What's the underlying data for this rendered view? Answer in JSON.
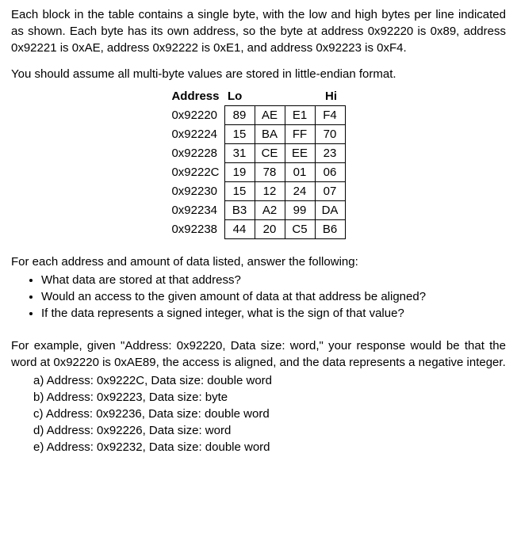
{
  "intro_para": "Each block in the table contains a single byte, with the low and high bytes per line indicated as shown. Each byte has its own address, so the byte at address 0x92220 is 0x89, address 0x92221 is 0xAE, address 0x92222 is 0xE1, and address 0x92223 is 0xF4.",
  "assume_para": "You should assume all multi-byte values are stored in little-endian format.",
  "table": {
    "header_addr": "Address",
    "header_lo": "Lo",
    "header_hi": "Hi",
    "rows": [
      {
        "addr": "0x92220",
        "b0": "89",
        "b1": "AE",
        "b2": "E1",
        "b3": "F4"
      },
      {
        "addr": "0x92224",
        "b0": "15",
        "b1": "BA",
        "b2": "FF",
        "b3": "70"
      },
      {
        "addr": "0x92228",
        "b0": "31",
        "b1": "CE",
        "b2": "EE",
        "b3": "23"
      },
      {
        "addr": "0x9222C",
        "b0": "19",
        "b1": "78",
        "b2": "01",
        "b3": "06"
      },
      {
        "addr": "0x92230",
        "b0": "15",
        "b1": "12",
        "b2": "24",
        "b3": "07"
      },
      {
        "addr": "0x92234",
        "b0": "B3",
        "b1": "A2",
        "b2": "99",
        "b3": "DA"
      },
      {
        "addr": "0x92238",
        "b0": "44",
        "b1": "20",
        "b2": "C5",
        "b3": "B6"
      }
    ]
  },
  "question_intro": "For each address and amount of data listed, answer the following:",
  "bullets": [
    "What data are stored at that address?",
    "Would an access to the given amount of data at that address be aligned?",
    "If the data represents a signed integer, what is the sign of that value?"
  ],
  "example_para": "For example, given \"Address: 0x92220, Data size: word,\" your response would be that the word at 0x92220 is 0xAE89, the access is aligned, and the data represents a negative integer.",
  "subq": [
    "a)  Address: 0x9222C, Data size: double word",
    "b)  Address: 0x92223, Data size: byte",
    "c)  Address: 0x92236, Data size: double word",
    "d)  Address: 0x92226, Data size: word",
    "e)  Address: 0x92232, Data size: double word"
  ]
}
